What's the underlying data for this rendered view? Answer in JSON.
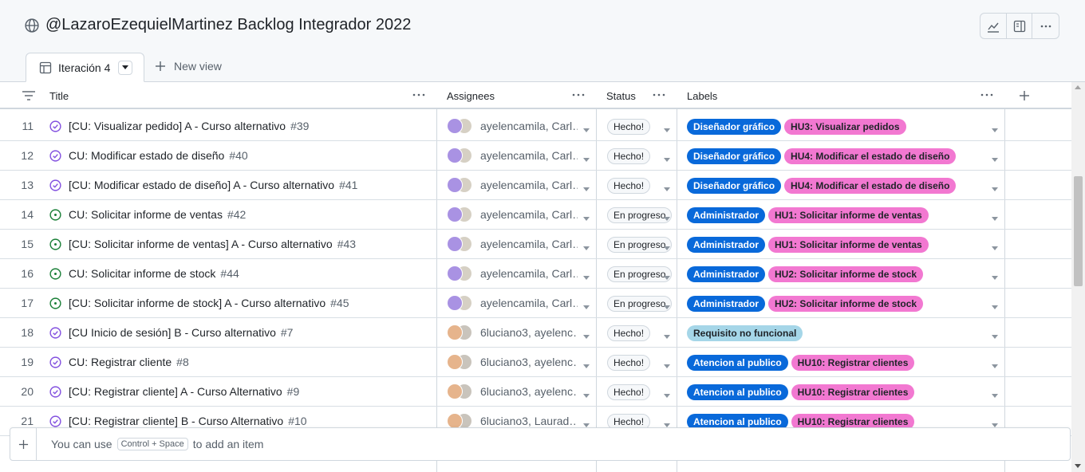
{
  "project": {
    "title": "@LazaroEzequielMartinez Backlog Integrador 2022"
  },
  "toolbar": {
    "icons": [
      "insights-icon",
      "side-panel-icon",
      "more-icon"
    ]
  },
  "tabs": {
    "active_label": "Iteración 4",
    "new_view_label": "New view"
  },
  "columns": {
    "title": "Title",
    "assignees": "Assignees",
    "status": "Status",
    "labels": "Labels"
  },
  "colors": {
    "closed": "#8250df",
    "open": "#1a7f37",
    "label_blue_bg": "#0969da",
    "label_pink_bg": "#f278d1",
    "label_light_bg": "#a5d6e8"
  },
  "rows": [
    {
      "num": "11",
      "state": "closed",
      "title": "[CU: Visualizar pedido] A - Curso alternativo",
      "issue": "#39",
      "avatars": "purple",
      "assignees": "ayelencamila, Carl…",
      "status": "Hecho!",
      "labels": [
        {
          "text": "Diseñador gráfico",
          "kind": "blue"
        },
        {
          "text": "HU3: Visualizar pedidos",
          "kind": "pink"
        }
      ]
    },
    {
      "num": "12",
      "state": "closed",
      "title": "CU: Modificar estado de diseño",
      "issue": "#40",
      "avatars": "purple",
      "assignees": "ayelencamila, Carl…",
      "status": "Hecho!",
      "labels": [
        {
          "text": "Diseñador gráfico",
          "kind": "blue"
        },
        {
          "text": "HU4: Modificar el estado de diseño",
          "kind": "pink"
        }
      ]
    },
    {
      "num": "13",
      "state": "closed",
      "title": "[CU: Modificar estado de diseño] A - Curso alternativo",
      "issue": "#41",
      "avatars": "purple",
      "assignees": "ayelencamila, Carl…",
      "status": "Hecho!",
      "labels": [
        {
          "text": "Diseñador gráfico",
          "kind": "blue"
        },
        {
          "text": "HU4: Modificar el estado de diseño",
          "kind": "pink"
        }
      ]
    },
    {
      "num": "14",
      "state": "open",
      "title": "CU: Solicitar informe de ventas",
      "issue": "#42",
      "avatars": "purple",
      "assignees": "ayelencamila, Carl…",
      "status": "En progreso",
      "labels": [
        {
          "text": "Administrador",
          "kind": "blue"
        },
        {
          "text": "HU1: Solicitar informe de ventas",
          "kind": "pink"
        }
      ]
    },
    {
      "num": "15",
      "state": "open",
      "title": "[CU: Solicitar informe de ventas] A - Curso alternativo",
      "issue": "#43",
      "avatars": "purple",
      "assignees": "ayelencamila, Carl…",
      "status": "En progreso",
      "labels": [
        {
          "text": "Administrador",
          "kind": "blue"
        },
        {
          "text": "HU1: Solicitar informe de ventas",
          "kind": "pink"
        }
      ]
    },
    {
      "num": "16",
      "state": "open",
      "title": "CU: Solicitar informe de stock",
      "issue": "#44",
      "avatars": "purple",
      "assignees": "ayelencamila, Carl…",
      "status": "En progreso",
      "labels": [
        {
          "text": "Administrador",
          "kind": "blue"
        },
        {
          "text": "HU2: Solicitar informe de stock",
          "kind": "pink"
        }
      ]
    },
    {
      "num": "17",
      "state": "open",
      "title": "[CU: Solicitar informe de stock] A - Curso alternativo",
      "issue": "#45",
      "avatars": "purple",
      "assignees": "ayelencamila, Carl…",
      "status": "En progreso",
      "labels": [
        {
          "text": "Administrador",
          "kind": "blue"
        },
        {
          "text": "HU2: Solicitar informe de stock",
          "kind": "pink"
        }
      ]
    },
    {
      "num": "18",
      "state": "closed",
      "title": "[CU Inicio de sesión] B - Curso alternativo",
      "issue": "#7",
      "avatars": "orange",
      "assignees": "6luciano3, ayelenc…",
      "status": "Hecho!",
      "labels": [
        {
          "text": "Requisito no funcional",
          "kind": "light"
        }
      ]
    },
    {
      "num": "19",
      "state": "closed",
      "title": "CU: Registrar cliente",
      "issue": "#8",
      "avatars": "orange",
      "assignees": "6luciano3, ayelenc…",
      "status": "Hecho!",
      "labels": [
        {
          "text": "Atencion al publico",
          "kind": "blue"
        },
        {
          "text": "HU10: Registrar clientes",
          "kind": "pink"
        }
      ]
    },
    {
      "num": "20",
      "state": "closed",
      "title": "[CU: Registrar cliente] A - Curso Alternativo",
      "issue": "#9",
      "avatars": "orange",
      "assignees": "6luciano3, ayelenc…",
      "status": "Hecho!",
      "labels": [
        {
          "text": "Atencion al publico",
          "kind": "blue"
        },
        {
          "text": "HU10: Registrar clientes",
          "kind": "pink"
        }
      ]
    },
    {
      "num": "21",
      "state": "closed",
      "title": "[CU: Registrar cliente] B - Curso Alternativo",
      "issue": "#10",
      "avatars": "orange",
      "assignees": "6luciano3, Laurad…",
      "status": "Hecho!",
      "labels": [
        {
          "text": "Atencion al publico",
          "kind": "blue"
        },
        {
          "text": "HU10: Registrar clientes",
          "kind": "pink"
        }
      ]
    }
  ],
  "footer": {
    "prefix": "You can use",
    "kbd": "Control + Space",
    "suffix": "to add an item"
  }
}
